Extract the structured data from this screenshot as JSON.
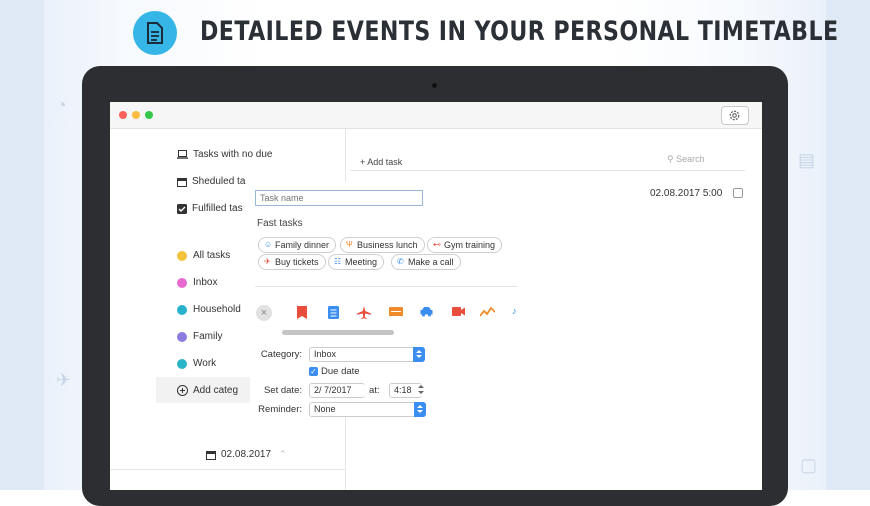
{
  "headline": "DETAILED EVENTS IN YOUR PERSONAL TIMETABLE",
  "sidebar": {
    "items": [
      {
        "label": "Tasks with no due",
        "icon": "laptop-icon"
      },
      {
        "label": "Sheduled ta",
        "icon": "calendar-icon"
      },
      {
        "label": "Fulfilled tas",
        "icon": "checkbox-icon"
      }
    ],
    "categories": [
      {
        "label": "All tasks",
        "color": "#f3c33b"
      },
      {
        "label": "Inbox",
        "color": "#e86ad0"
      },
      {
        "label": "Household",
        "color": "#27b1cf"
      },
      {
        "label": "Family",
        "color": "#8b7ce0"
      },
      {
        "label": "Work",
        "color": "#2ab4c8"
      }
    ],
    "add_category": "Add categ",
    "footer_date": "02.08.2017"
  },
  "main": {
    "add_task": "+ Add task",
    "search_placeholder": "Search",
    "task_date": "02.08.2017 5:00"
  },
  "popover": {
    "task_name_placeholder": "Task name",
    "fast_tasks_title": "Fast tasks",
    "fast_tasks": [
      {
        "label": "Family dinner",
        "icon": "people-icon",
        "color": "#3b8ef0"
      },
      {
        "label": "Business lunch",
        "icon": "fork-icon",
        "color": "#f08a2a"
      },
      {
        "label": "Gym training",
        "icon": "dumbbell-icon",
        "color": "#e94d3b"
      },
      {
        "label": "Buy tickets",
        "icon": "plane-icon",
        "color": "#e94d3b"
      },
      {
        "label": "Meeting",
        "icon": "group-icon",
        "color": "#3b8ef0"
      },
      {
        "label": "Make a call",
        "icon": "phone-icon",
        "color": "#3b8ef0"
      }
    ],
    "icon_colors": {
      "bookmark": "#e94d3b",
      "document": "#3b8ef0",
      "plane": "#e94d3b",
      "ticket": "#f08a2a",
      "car": "#3b8ef0",
      "video": "#e94d3b",
      "chart": "#f08a2a"
    },
    "form": {
      "category_label": "Category:",
      "category_value": "Inbox",
      "due_date_label": "Due date",
      "due_date_checked": true,
      "set_date_label": "Set date:",
      "date_value": "2/ 7/2017",
      "at_label": "at:",
      "time_value": "4:18",
      "reminder_label": "Reminder:",
      "reminder_value": "None"
    }
  }
}
